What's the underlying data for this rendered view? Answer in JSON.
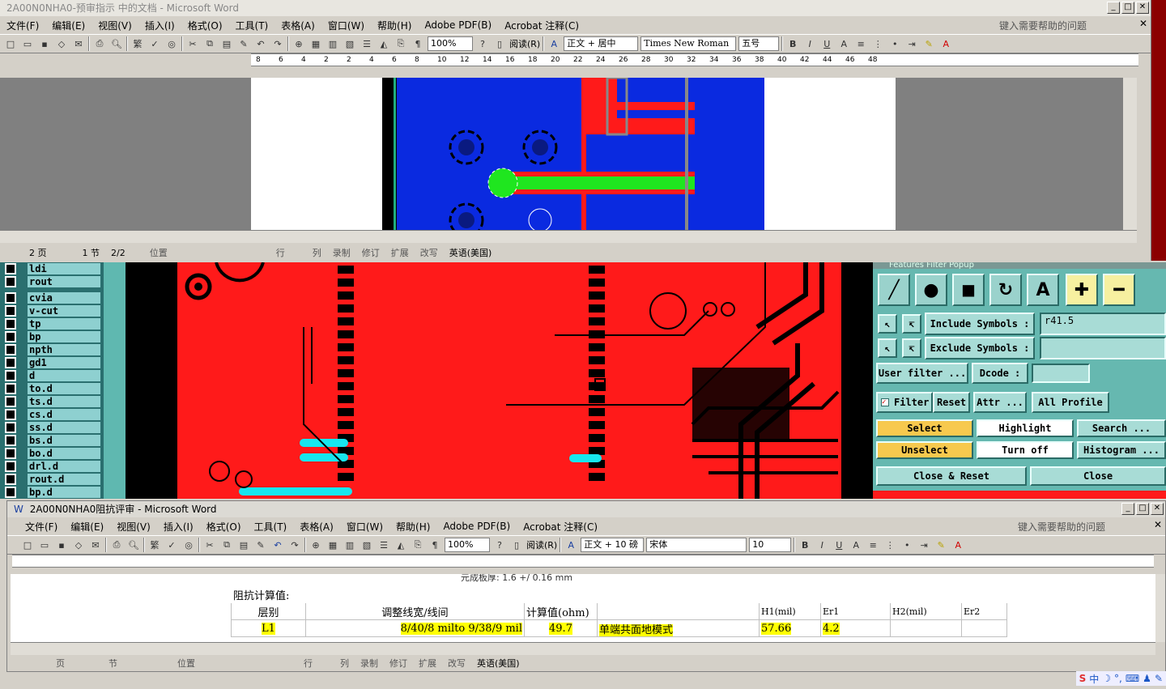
{
  "word1": {
    "title": "2A00N0NHA0-预审指示 中的文档 - Microsoft Word",
    "help_placeholder": "键入需要帮助的问题",
    "menus": [
      "文件(F)",
      "编辑(E)",
      "视图(V)",
      "插入(I)",
      "格式(O)",
      "工具(T)",
      "表格(A)",
      "窗口(W)",
      "帮助(H)",
      "Adobe PDF(B)",
      "Acrobat 注释(C)"
    ],
    "zoom": "100%",
    "read_label": "阅读(R)",
    "style": "正文 + 居中",
    "font": "Times New Roman",
    "size": "五号",
    "ruler_labels": [
      "8",
      "6",
      "4",
      "2",
      "2",
      "4",
      "6",
      "8",
      "10",
      "12",
      "14",
      "16",
      "18",
      "20",
      "22",
      "24",
      "26",
      "28",
      "30",
      "32",
      "34",
      "36",
      "38",
      "40",
      "42",
      "44",
      "46",
      "48"
    ],
    "status": {
      "page": "2 页",
      "section": "1 节",
      "pages": "2/2",
      "position": "位置",
      "row": "行",
      "col": "列",
      "rec": "录制",
      "trk": "修订",
      "ext": "扩展",
      "ovr": "改写",
      "lang": "英语(美国)"
    }
  },
  "layers": [
    "ldi",
    "rout",
    "cvia",
    "v-cut",
    "tp",
    "bp",
    "npth",
    "gd1",
    "d",
    "to.d",
    "ts.d",
    "cs.d",
    "ss.d",
    "bs.d",
    "bo.d",
    "drl.d",
    "rout.d",
    "bp.d"
  ],
  "filter_popup": {
    "title": "Features Filter Popup",
    "include_label": "Include Symbols :",
    "include_value": "r41.5",
    "exclude_label": "Exclude Symbols :",
    "exclude_value": "",
    "user_filter": "User filter ...",
    "dcode": "Dcode :",
    "filter_label": "Filter",
    "reset": "Reset",
    "attr": "Attr ...",
    "all_profile": "All Profile",
    "select": "Select",
    "highlight": "Highlight",
    "search": "Search ...",
    "unselect": "Unselect",
    "turn_off": "Turn off",
    "histogram": "Histogram ...",
    "close_reset": "Close & Reset",
    "close": "Close"
  },
  "word2": {
    "title": "2A00N0NHA0阻抗评审 - Microsoft Word",
    "help_placeholder": "键入需要帮助的问题",
    "menus": [
      "文件(F)",
      "编辑(E)",
      "视图(V)",
      "插入(I)",
      "格式(O)",
      "工具(T)",
      "表格(A)",
      "窗口(W)",
      "帮助(H)",
      "Adobe PDF(B)",
      "Acrobat 注释(C)"
    ],
    "zoom": "100%",
    "read_label": "阅读(R)",
    "style": "正文 + 10 磅",
    "font": "宋体",
    "size": "10",
    "table_top": "元成板厚: 1.6 +/ 0.16 mm",
    "table_title": "阻抗计算值:",
    "headers": [
      "层别",
      "调整线宽/线间",
      "计算值(ohm)",
      "",
      "H1(mil)",
      "Er1",
      "H2(mil)",
      "Er2"
    ],
    "row": [
      "L1",
      "8/40/8 milto 9/38/9 mil",
      "49.7",
      "单端共面地模式",
      "57.66",
      "4.2",
      "",
      ""
    ],
    "status": {
      "page": "页",
      "section": "节",
      "position": "位置",
      "row": "行",
      "col": "列",
      "rec": "录制",
      "trk": "修订",
      "ext": "扩展",
      "ovr": "改写",
      "lang": "英语(美国)"
    }
  },
  "tray": {
    "ime": "中"
  }
}
